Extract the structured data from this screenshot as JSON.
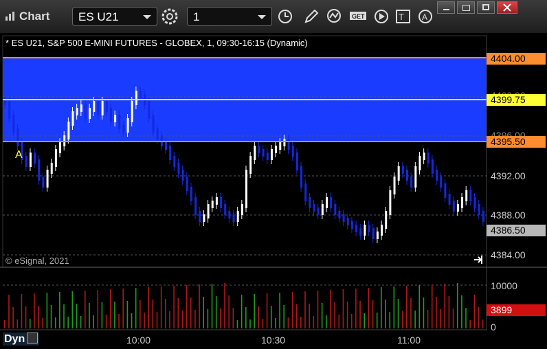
{
  "window": {
    "title": "Chart",
    "symbol_field": "ES U21",
    "interval_field": "1"
  },
  "chart": {
    "header": "* ES U21, S&P 500 E-MINI FUTURES - GLOBEX, 1, 09:30-16:15 (Dynamic)",
    "copyright": "© eSignal, 2021",
    "marker_label": "A",
    "price_axis": [
      "4392.00",
      "4388.00",
      "4384.00"
    ],
    "price_axis_hidden": [
      "4400.00",
      "4396.00"
    ],
    "price_boxes": {
      "upper": "4404.00",
      "mid": "4399.75",
      "lower": "4395.50",
      "last": "4386.50"
    },
    "volume_axis": [
      "10000",
      "0"
    ],
    "volume_box": "3899",
    "time_axis": [
      "10:00",
      "10:30",
      "11:00"
    ],
    "footer_label": "Dyn",
    "colors": {
      "zone": "#1a3cff",
      "zone_border": "#ff8c2e",
      "mid_line": "#ffff33",
      "up_candle": "#ffffff",
      "down_candle": "#1428e0",
      "vol_up": "#1e9e1e",
      "vol_down": "#b01818"
    }
  }
}
